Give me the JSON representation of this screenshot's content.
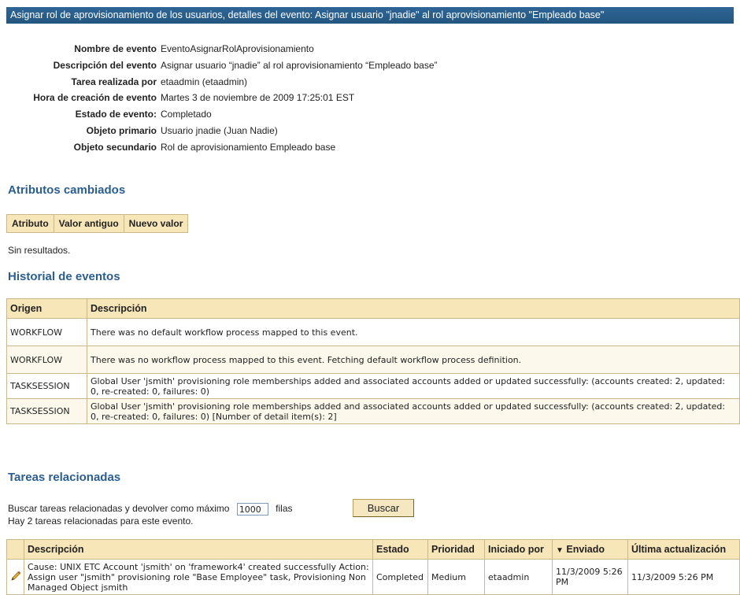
{
  "title": "Asignar rol de aprovisionamiento de los usuarios, detalles del evento: Asignar usuario \"jnadie\" al rol aprovisionamiento \"Empleado base\"",
  "details": [
    {
      "label": "Nombre de evento",
      "value": "EventoAsignarRolAprovisionamiento"
    },
    {
      "label": "Descripción del evento",
      "value": "Asignar usuario “jnadie” al rol aprovisionamiento “Empleado base”"
    },
    {
      "label": "Tarea realizada por",
      "value": "etaadmin (etaadmin)"
    },
    {
      "label": "Hora de creación de evento",
      "value": "Martes 3 de noviembre de 2009 17:25:01 EST"
    },
    {
      "label": "Estado de evento:",
      "value": "Completado"
    },
    {
      "label": "Objeto primario",
      "value": "Usuario jnadie (Juan Nadie)"
    },
    {
      "label": "Objeto secundario",
      "value": "Rol de aprovisionamiento Empleado base"
    }
  ],
  "changed_attributes": {
    "heading": "Atributos cambiados",
    "columns": [
      "Atributo",
      "Valor antiguo",
      "Nuevo valor"
    ],
    "empty_text": "Sin resultados."
  },
  "event_history": {
    "heading": "Historial de eventos",
    "columns": [
      "Origen",
      "Descripción"
    ],
    "rows": [
      {
        "origin": "WORKFLOW",
        "description": "There was no default workflow process mapped to this event."
      },
      {
        "origin": "WORKFLOW",
        "description": "There was no workflow process mapped to this event. Fetching default workflow process definition."
      },
      {
        "origin": "TASKSESSION",
        "description": "Global User 'jsmith' provisioning role memberships added and associated accounts added or updated successfully: (accounts created: 2, updated: 0, re-created: 0, failures: 0)"
      },
      {
        "origin": "TASKSESSION",
        "description": "Global User 'jsmith' provisioning role memberships added and associated accounts added or updated successfully: (accounts created: 2, updated: 0, re-created: 0, failures: 0) [Number of detail item(s): 2]"
      }
    ]
  },
  "related_tasks": {
    "heading": "Tareas relacionadas",
    "search_prefix": "Buscar tareas relacionadas y devolver como máximo",
    "max_value": "1000",
    "search_suffix": "filas",
    "search_button": "Buscar",
    "count_text": "Hay 2 tareas relacionadas para este evento.",
    "columns": [
      "Descripción",
      "Estado",
      "Prioridad",
      "Iniciado por",
      "Enviado",
      "Última actualización"
    ],
    "sorted_column_marker": "▼",
    "rows": [
      {
        "description": "Cause: UNIX ETC Account 'jsmith' on 'framework4' created successfully Action: Assign user \"jsmith\" provisioning role \"Base Employee\" task, Provisioning Non Managed Object jsmith",
        "status": "Completed",
        "priority": "Medium",
        "initiated_by": "etaadmin",
        "sent": "11/3/2009 5:26 PM",
        "updated": "11/3/2009 5:26 PM",
        "icon": "pencil-icon"
      }
    ]
  },
  "colors": {
    "title_bar": "#2a5e8c",
    "section_heading": "#2a5e91",
    "table_header": "#f7e6b8",
    "table_border": "#c8b88a"
  }
}
